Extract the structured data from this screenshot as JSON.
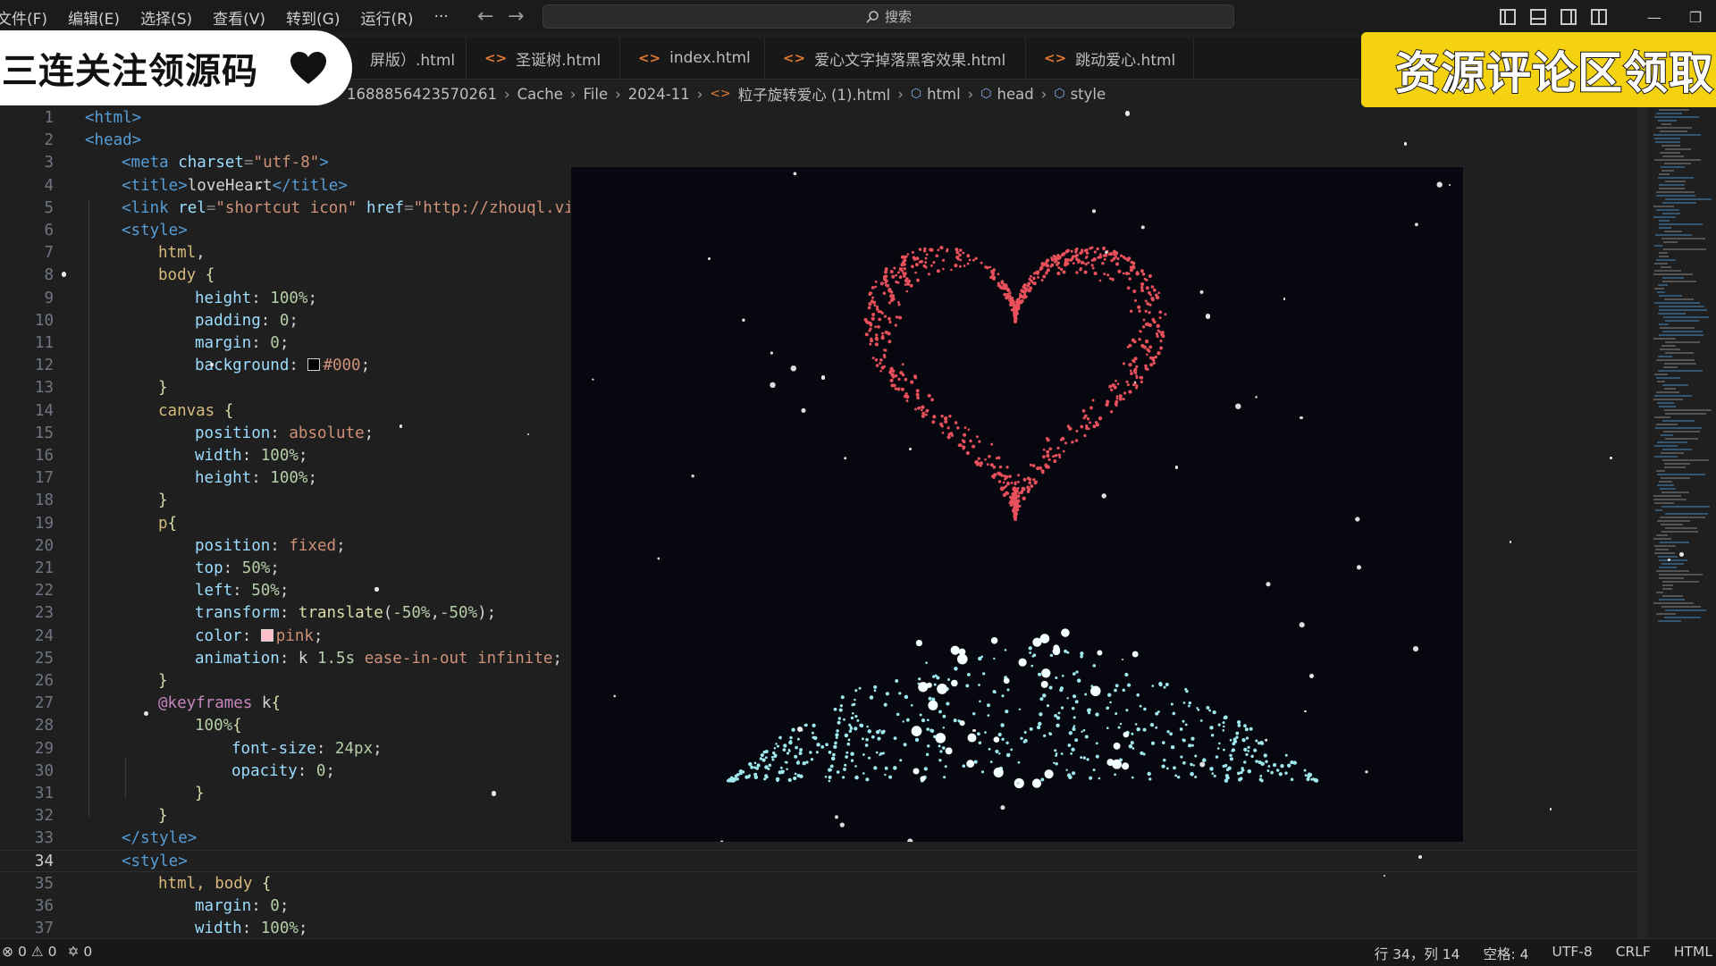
{
  "menu": [
    "文件(F)",
    "编辑(E)",
    "选择(S)",
    "查看(V)",
    "转到(G)",
    "运行(R)",
    "···"
  ],
  "search": {
    "label": "搜索"
  },
  "tabs": [
    {
      "label": "屏版）.html"
    },
    {
      "label": "圣诞树.html"
    },
    {
      "label": "index.html"
    },
    {
      "label": "爱心文字掉落黑客效果.html"
    },
    {
      "label": "跳动爱心.html"
    }
  ],
  "breadcrumb": [
    "1688856423570261",
    "Cache",
    "File",
    "2024-11",
    "粒子旋转爱心 (1).html",
    "html",
    "head",
    "style"
  ],
  "editor": {
    "active_line": "34",
    "lines": [
      {
        "n": "1",
        "tokens": [
          [
            "tag",
            "<html>"
          ]
        ],
        "indent": 0
      },
      {
        "n": "2",
        "tokens": [
          [
            "tag",
            "<head>"
          ]
        ],
        "indent": 0
      },
      {
        "n": "3",
        "tokens": [
          [
            "tag",
            "<meta "
          ],
          [
            "attr",
            "charset"
          ],
          [
            "punc",
            "="
          ],
          [
            "str",
            "\"utf-8\""
          ],
          [
            "tag",
            ">"
          ]
        ],
        "indent": 1
      },
      {
        "n": "4",
        "tokens": [
          [
            "tag",
            "<title>"
          ],
          [
            "plain",
            "loveHeart"
          ],
          [
            "tag",
            "</title>"
          ]
        ],
        "indent": 1
      },
      {
        "n": "5",
        "tokens": [
          [
            "tag",
            "<link "
          ],
          [
            "attr",
            "rel"
          ],
          [
            "punc",
            "="
          ],
          [
            "str",
            "\"shortcut icon\" "
          ],
          [
            "attr",
            "href"
          ],
          [
            "punc",
            "="
          ],
          [
            "str",
            "\"http://zhouql.vip"
          ]
        ],
        "indent": 1
      },
      {
        "n": "6",
        "tokens": [
          [
            "tag",
            "<style>"
          ]
        ],
        "indent": 1
      },
      {
        "n": "7",
        "tokens": [
          [
            "sel",
            "html"
          ],
          [
            "plain",
            ","
          ]
        ],
        "indent": 2
      },
      {
        "n": "8",
        "tokens": [
          [
            "sel",
            "body "
          ],
          [
            "fn",
            "{"
          ]
        ],
        "indent": 2
      },
      {
        "n": "9",
        "tokens": [
          [
            "prop",
            "height"
          ],
          [
            "plain",
            ": "
          ],
          [
            "num",
            "100%"
          ],
          [
            "plain",
            ";"
          ]
        ],
        "indent": 3
      },
      {
        "n": "10",
        "tokens": [
          [
            "prop",
            "padding"
          ],
          [
            "plain",
            ": "
          ],
          [
            "num",
            "0"
          ],
          [
            "plain",
            ";"
          ]
        ],
        "indent": 3
      },
      {
        "n": "11",
        "tokens": [
          [
            "prop",
            "margin"
          ],
          [
            "plain",
            ": "
          ],
          [
            "num",
            "0"
          ],
          [
            "plain",
            ";"
          ]
        ],
        "indent": 3
      },
      {
        "n": "12",
        "tokens": [
          [
            "prop",
            "background"
          ],
          [
            "plain",
            ": "
          ],
          [
            "swatch",
            "#000"
          ],
          [
            "val",
            "#000"
          ],
          [
            "plain",
            ";"
          ]
        ],
        "indent": 3
      },
      {
        "n": "13",
        "tokens": [
          [
            "fn",
            "}"
          ]
        ],
        "indent": 2
      },
      {
        "n": "14",
        "tokens": [
          [
            "sel",
            "canvas "
          ],
          [
            "fn",
            "{"
          ]
        ],
        "indent": 2
      },
      {
        "n": "15",
        "tokens": [
          [
            "prop",
            "position"
          ],
          [
            "plain",
            ": "
          ],
          [
            "val",
            "absolute"
          ],
          [
            "plain",
            ";"
          ]
        ],
        "indent": 3
      },
      {
        "n": "16",
        "tokens": [
          [
            "prop",
            "width"
          ],
          [
            "plain",
            ": "
          ],
          [
            "num",
            "100%"
          ],
          [
            "plain",
            ";"
          ]
        ],
        "indent": 3
      },
      {
        "n": "17",
        "tokens": [
          [
            "prop",
            "height"
          ],
          [
            "plain",
            ": "
          ],
          [
            "num",
            "100%"
          ],
          [
            "plain",
            ";"
          ]
        ],
        "indent": 3
      },
      {
        "n": "18",
        "tokens": [
          [
            "fn",
            "}"
          ]
        ],
        "indent": 2
      },
      {
        "n": "19",
        "tokens": [
          [
            "sel",
            "p"
          ],
          [
            "fn",
            "{"
          ]
        ],
        "indent": 2
      },
      {
        "n": "20",
        "tokens": [
          [
            "prop",
            "position"
          ],
          [
            "plain",
            ": "
          ],
          [
            "val",
            "fixed"
          ],
          [
            "plain",
            ";"
          ]
        ],
        "indent": 3
      },
      {
        "n": "21",
        "tokens": [
          [
            "prop",
            "top"
          ],
          [
            "plain",
            ": "
          ],
          [
            "num",
            "50%"
          ],
          [
            "plain",
            ";"
          ]
        ],
        "indent": 3
      },
      {
        "n": "22",
        "tokens": [
          [
            "prop",
            "left"
          ],
          [
            "plain",
            ": "
          ],
          [
            "num",
            "50%"
          ],
          [
            "plain",
            ";"
          ]
        ],
        "indent": 3
      },
      {
        "n": "23",
        "tokens": [
          [
            "prop",
            "transform"
          ],
          [
            "plain",
            ": "
          ],
          [
            "fn",
            "translate"
          ],
          [
            "plain",
            "("
          ],
          [
            "num",
            "-50%"
          ],
          [
            "plain",
            ","
          ],
          [
            "num",
            "-50%"
          ],
          [
            "plain",
            ");"
          ]
        ],
        "indent": 3
      },
      {
        "n": "24",
        "tokens": [
          [
            "prop",
            "color"
          ],
          [
            "plain",
            ": "
          ],
          [
            "swatch",
            "pink"
          ],
          [
            "val",
            "pink"
          ],
          [
            "plain",
            ";"
          ]
        ],
        "indent": 3
      },
      {
        "n": "25",
        "tokens": [
          [
            "prop",
            "animation"
          ],
          [
            "plain",
            ": k "
          ],
          [
            "num",
            "1.5s"
          ],
          [
            "plain",
            " "
          ],
          [
            "val",
            "ease-in-out infinite"
          ],
          [
            "plain",
            ";"
          ]
        ],
        "indent": 3
      },
      {
        "n": "26",
        "tokens": [
          [
            "fn",
            "}"
          ]
        ],
        "indent": 2
      },
      {
        "n": "27",
        "tokens": [
          [
            "kw",
            "@keyframes"
          ],
          [
            "plain",
            " k"
          ],
          [
            "fn",
            "{"
          ]
        ],
        "indent": 2
      },
      {
        "n": "28",
        "tokens": [
          [
            "num",
            "100%"
          ],
          [
            "fn",
            "{"
          ]
        ],
        "indent": 3
      },
      {
        "n": "29",
        "tokens": [
          [
            "prop",
            "font-size"
          ],
          [
            "plain",
            ": "
          ],
          [
            "num",
            "24px"
          ],
          [
            "plain",
            ";"
          ]
        ],
        "indent": 4
      },
      {
        "n": "30",
        "tokens": [
          [
            "prop",
            "opacity"
          ],
          [
            "plain",
            ": "
          ],
          [
            "num",
            "0"
          ],
          [
            "plain",
            ";"
          ]
        ],
        "indent": 4
      },
      {
        "n": "31",
        "tokens": [
          [
            "fn",
            "}"
          ]
        ],
        "indent": 3
      },
      {
        "n": "32",
        "tokens": [
          [
            "fn",
            "}"
          ]
        ],
        "indent": 2
      },
      {
        "n": "33",
        "tokens": [
          [
            "tag",
            "</style>"
          ]
        ],
        "indent": 1
      },
      {
        "n": "34",
        "tokens": [
          [
            "tag",
            "<style>"
          ]
        ],
        "indent": 1
      },
      {
        "n": "35",
        "tokens": [
          [
            "sel",
            "html, body "
          ],
          [
            "fn",
            "{"
          ]
        ],
        "indent": 2
      },
      {
        "n": "36",
        "tokens": [
          [
            "prop",
            "margin"
          ],
          [
            "plain",
            ": "
          ],
          [
            "num",
            "0"
          ],
          [
            "plain",
            ";"
          ]
        ],
        "indent": 3
      },
      {
        "n": "37",
        "tokens": [
          [
            "prop",
            "width"
          ],
          [
            "plain",
            ": "
          ],
          [
            "num",
            "100%"
          ],
          [
            "plain",
            ";"
          ]
        ],
        "indent": 3
      }
    ]
  },
  "preview": {
    "heart_color": "#e8505b",
    "ground_color": "#9fe8ee",
    "background": "#06070f"
  },
  "status": {
    "errors": "0",
    "warnings": "0",
    "ports": "0",
    "position": "行 34，列 14",
    "spaces": "空格: 4",
    "encoding": "UTF-8",
    "eol": "CRLF",
    "language": "HTML"
  },
  "promo": {
    "left_text": "三连关注领源码",
    "right_text": "资源评论区领取"
  }
}
